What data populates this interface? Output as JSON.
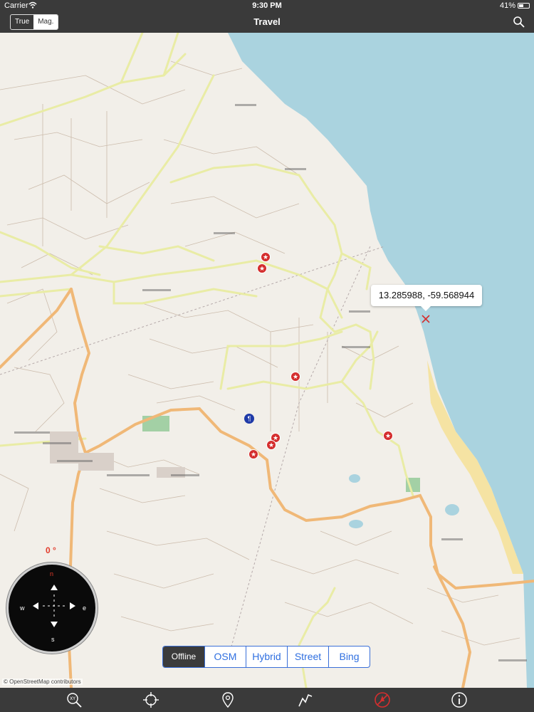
{
  "status": {
    "carrier": "Carrier",
    "time": "9:30 PM",
    "battery": "41%"
  },
  "navbar": {
    "title": "Travel",
    "north_true": "True",
    "north_mag": "Mag.",
    "search_icon": "search-icon"
  },
  "map": {
    "popup_coords": "13.285988, -59.568944",
    "heading": "0 °",
    "attribution": "© OpenStreetMap contributors",
    "colors": {
      "land": "#f2efe9",
      "sea": "#aad3df",
      "secondary_road": "#e9eca5",
      "primary_road": "#f0b877",
      "minor_road": "#c8b7a6",
      "pin": "#d42e2e"
    }
  },
  "compass": {
    "n": "n",
    "s": "s",
    "e": "e",
    "w": "w"
  },
  "layers": {
    "offline": "Offline",
    "osm": "OSM",
    "hybrid": "Hybrid",
    "street": "Street",
    "bing": "Bing",
    "selected": "Offline"
  },
  "tabbar": {
    "icons": [
      "xy-search-icon",
      "crosshair-icon",
      "location-pin-icon",
      "route-icon",
      "compass-disabled-icon",
      "info-icon"
    ]
  }
}
